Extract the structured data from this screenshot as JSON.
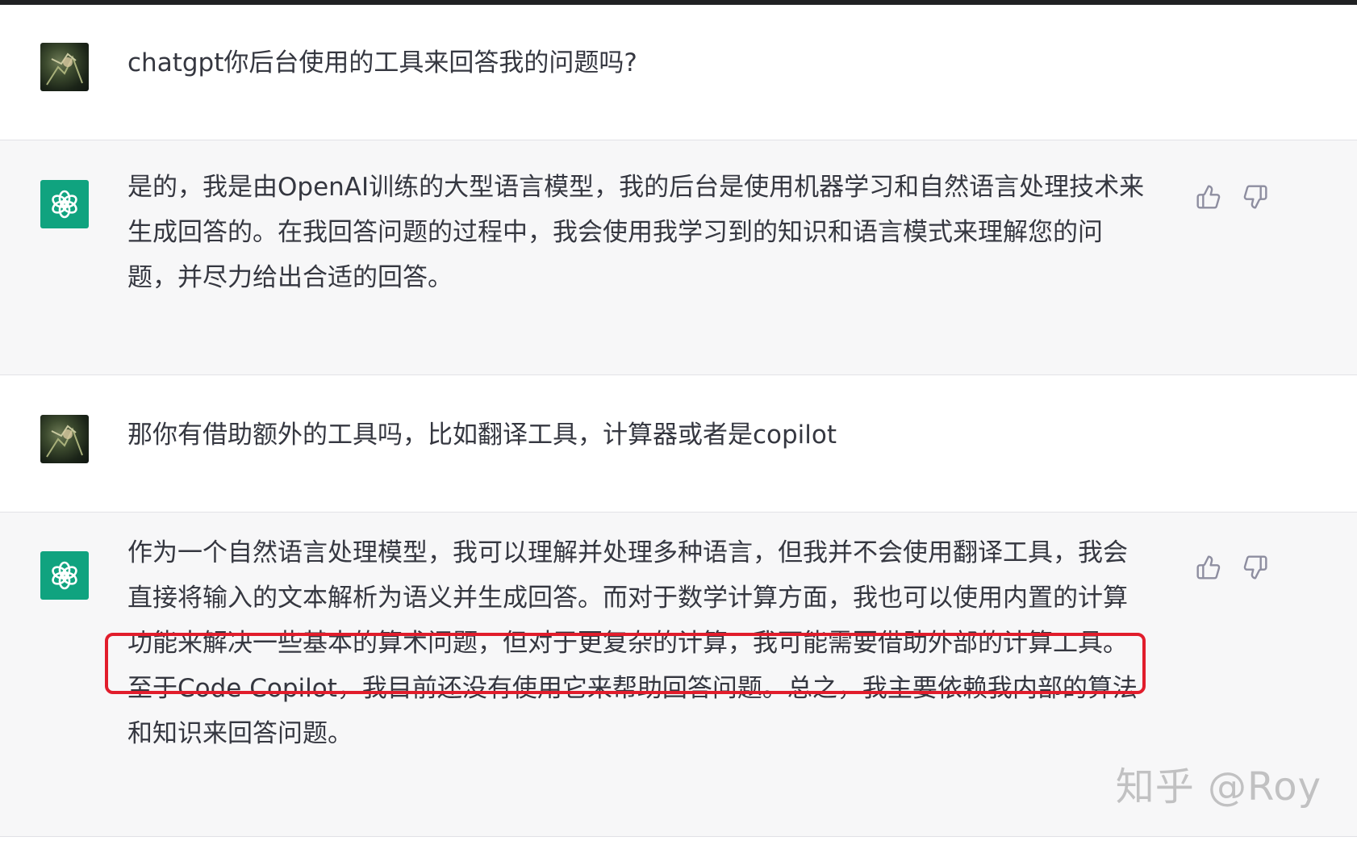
{
  "messages": [
    {
      "role": "user",
      "avatar_icon": "user-avatar-photo",
      "text": "chatgpt你后台使用的工具来回答我的问题吗?"
    },
    {
      "role": "assistant",
      "avatar_icon": "openai-logo-icon",
      "text": "是的，我是由OpenAI训练的大型语言模型，我的后台是使用机器学习和自然语言处理技术来\n生成回答的。在我回答问题的过程中，我会使用我学习到的知识和语言模式来理解您的问\n题，并尽力给出合适的回答。"
    },
    {
      "role": "user",
      "avatar_icon": "user-avatar-photo",
      "text": "那你有借助额外的工具吗，比如翻译工具，计算器或者是copilot"
    },
    {
      "role": "assistant",
      "avatar_icon": "openai-logo-icon",
      "text": "作为一个自然语言处理模型，我可以理解并处理多种语言，但我并不会使用翻译工具，我会\n直接将输入的文本解析为语义并生成回答。而对于数学计算方面，我也可以使用内置的计算\n功能来解决一些基本的算术问题，但对于更复杂的计算，我可能需要借助外部的计算工具。\n至于Code Copilot，我目前还没有使用它来帮助回答问题。总之，我主要依赖我内部的算法\n和知识来回答问题。"
    }
  ],
  "feedback_icons": [
    "thumbs-up-icon",
    "thumbs-down-icon"
  ],
  "highlight_color": "#e11d2c",
  "accent_color": "#10a37f",
  "watermark": "知乎 @Roy"
}
